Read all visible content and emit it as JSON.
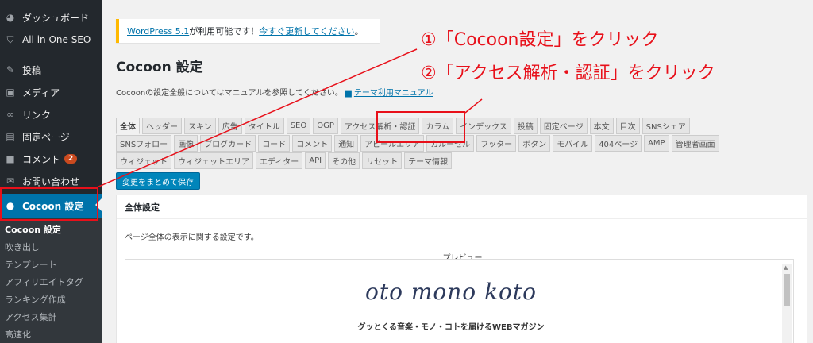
{
  "sidebar": {
    "items": [
      {
        "label": "ダッシュボード",
        "icon": "dashboard-icon"
      },
      {
        "label": "All in One SEO",
        "icon": "shield-icon"
      },
      {
        "label": "投稿",
        "icon": "pin-icon"
      },
      {
        "label": "メディア",
        "icon": "media-icon"
      },
      {
        "label": "リンク",
        "icon": "link-icon"
      },
      {
        "label": "固定ページ",
        "icon": "page-icon"
      },
      {
        "label": "コメント",
        "icon": "comment-icon",
        "badge": "2"
      },
      {
        "label": "お問い合わせ",
        "icon": "mail-icon"
      },
      {
        "label": "Cocoon 設定",
        "icon": "cocoon-icon"
      }
    ],
    "submenu": [
      "Cocoon 設定",
      "吹き出し",
      "テンプレート",
      "アフィリエイトタグ",
      "ランキング作成",
      "アクセス集計",
      "高速化"
    ]
  },
  "notice": {
    "version_link": "WordPress 5.1",
    "middle": " が利用可能です！",
    "update_link": "今すぐ更新してください",
    "end": "。"
  },
  "page": {
    "title": "Cocoon 設定",
    "desc": "Cocoonの設定全般についてはマニュアルを参照してください。",
    "manual_link": "テーマ利用マニュアル"
  },
  "tabs": {
    "row1": [
      "全体",
      "ヘッダー",
      "スキン",
      "広告",
      "タイトル",
      "SEO",
      "OGP",
      "アクセス解析・認証",
      "カラム",
      "インデックス",
      "投稿",
      "固定ページ",
      "本文",
      "目次",
      "SNSシェア"
    ],
    "row2": [
      "SNSフォロー",
      "画像",
      "ブログカード",
      "コード",
      "コメント",
      "通知",
      "アピールエリア",
      "カルーセル",
      "フッター",
      "ボタン",
      "モバイル",
      "404ページ",
      "AMP",
      "管理者画面"
    ],
    "row3": [
      "ウィジェット",
      "ウィジェットエリア",
      "エディター",
      "API",
      "その他",
      "リセット",
      "テーマ情報"
    ]
  },
  "save_label": "変更をまとめて保存",
  "panel": {
    "title": "全体設定",
    "desc": "ページ全体の表示に関する設定です。",
    "preview_label": "プレビュー",
    "logo": "oto mono koto",
    "tagline": "グッとくる音楽・モノ・コトを届けるWEBマガジン"
  },
  "annotations": {
    "step1": "①「Cocoon設定」をクリック",
    "step2": "②「アクセス解析・認証」をクリック"
  },
  "colors": {
    "accent": "#0073aa",
    "annotation": "#e8101a",
    "sidebar": "#23282d",
    "notice_border": "#ffb900"
  }
}
